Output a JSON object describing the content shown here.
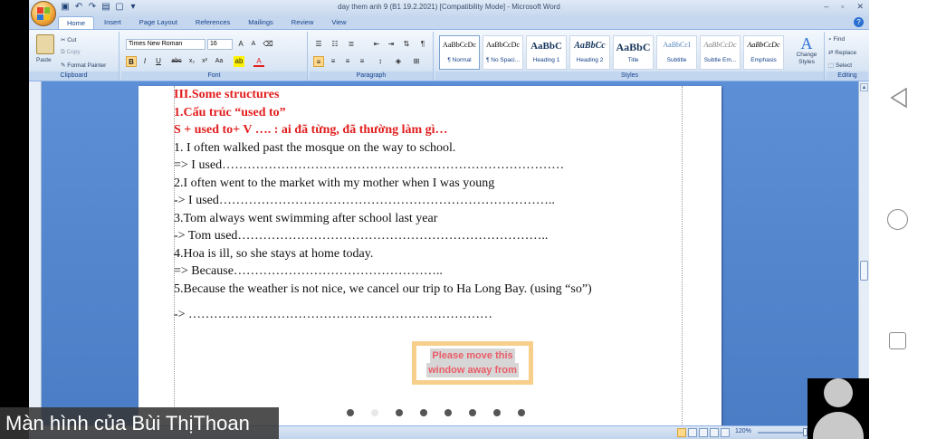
{
  "window": {
    "title": "day them anh 9 (B1  19.2.2021) [Compatibility Mode] - Microsoft Word",
    "minimize": "–",
    "maximize": "▫",
    "close": "✕"
  },
  "ribbon": {
    "tabs": [
      "Home",
      "Insert",
      "Page Layout",
      "References",
      "Mailings",
      "Review",
      "View"
    ],
    "active_tab": "Home",
    "clipboard": {
      "paste": "Paste",
      "cut": "Cut",
      "copy": "Copy",
      "format_painter": "Format Painter",
      "label": "Clipboard"
    },
    "font": {
      "name": "Times New Roman",
      "size": "16",
      "label": "Font"
    },
    "paragraph": {
      "label": "Paragraph"
    },
    "styles": {
      "label": "Styles",
      "items": [
        {
          "preview": "AaBbCcDc",
          "name": "¶ Normal"
        },
        {
          "preview": "AaBbCcDc",
          "name": "¶ No Spaci..."
        },
        {
          "preview": "AaBbC",
          "name": "Heading 1"
        },
        {
          "preview": "AaBbCc",
          "name": "Heading 2"
        },
        {
          "preview": "AaBbC",
          "name": "Title"
        },
        {
          "preview": "AaBbCcI",
          "name": "Subtitle"
        },
        {
          "preview": "AaBbCcDc",
          "name": "Subtle Em..."
        },
        {
          "preview": "AaBbCcDc",
          "name": "Emphasis"
        }
      ],
      "change_styles": "Change Styles"
    },
    "editing": {
      "find": "Find",
      "replace": "Replace",
      "select": "Select",
      "label": "Editing"
    }
  },
  "document": {
    "lines": [
      {
        "text": "III.Some structures",
        "style": "red"
      },
      {
        "text": "1.Cấu trúc “used to”",
        "style": "red"
      },
      {
        "text": "S + used to+ V …. : ai đã từng, đã thường làm gì…",
        "style": "red"
      },
      {
        "text": "1. I often walked past the mosque on the way to school.",
        "style": "normal"
      },
      {
        "text": "=> I used………………………………………………………………………",
        "style": "normal"
      },
      {
        "text": "2.I often went to the market with my mother when I was young",
        "style": "normal"
      },
      {
        "text": "-> I used……………………………………………………………………..",
        "style": "normal"
      },
      {
        "text": "3.Tom always went swimming after school last year",
        "style": "normal"
      },
      {
        "text": "-> Tom used………………………………………………………………..",
        "style": "normal"
      },
      {
        "text": "4.Hoa is ill, so she stays at home today.",
        "style": "normal"
      },
      {
        "text": "=> Because…………………………………………..",
        "style": "normal"
      },
      {
        "text": "5.Because the weather is not nice, we cancel our trip to Ha Long Bay. (using “so”)",
        "style": "normal"
      },
      {
        "text": "-> ………………………………………………………………",
        "style": "gap"
      }
    ],
    "overlay_line1": "Please move this",
    "overlay_line2": "window away from"
  },
  "status": {
    "zoom": "120%"
  },
  "pager": {
    "count": 8,
    "active_index": 1
  },
  "presenter": {
    "label": "Màn hình của Bùi ThịThoan"
  }
}
